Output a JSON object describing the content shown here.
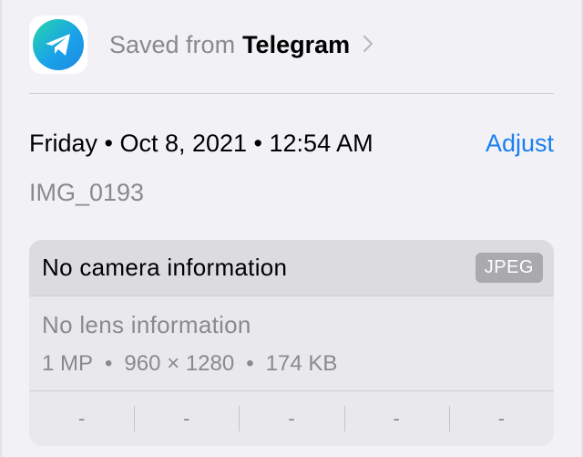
{
  "source": {
    "prefix": "Saved from",
    "app_name": "Telegram",
    "app_icon": "telegram-icon",
    "chevron_icon": "chevron-right-icon"
  },
  "date": {
    "text": "Friday • Oct 8, 2021 • 12:54 AM",
    "adjust_label": "Adjust"
  },
  "file": {
    "name": "IMG_0193"
  },
  "card": {
    "camera_info": "No camera information",
    "format_badge": "JPEG",
    "lens_info": "No lens information",
    "megapixels": "1 MP",
    "dimensions": "960 × 1280",
    "file_size": "174 KB",
    "separator": "•",
    "exif_values": [
      "-",
      "-",
      "-",
      "-",
      "-"
    ]
  },
  "colors": {
    "background": "#f2f2f6",
    "accent_link": "#1a7ff0",
    "secondary_text": "#8a8a8e",
    "badge": "#a9a9ae"
  }
}
